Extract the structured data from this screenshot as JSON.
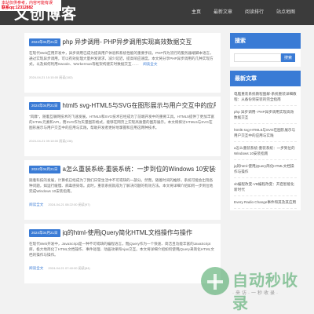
{
  "header": {
    "logo": "文创博客",
    "promo_line1": "本站仅供参考，内容可能有误",
    "promo_line2": "联系qq:12312882",
    "nav": [
      "主页",
      "最新文章",
      "阅读排行",
      "站点地图"
    ]
  },
  "posts": [
    {
      "date": "2024年04月21日",
      "title": "php 异步调用- PHP异步调用实现高效数据交互",
      "body": "在现代Web应用开发中，异步调用已成为提高用户体验和系统性能的重要手段。PHP作为流行的服务器端脚本语言，通过实现异步调用，可以有效处理大量并发请求，减少延迟，提高响应速度。本文将分享PHP异步调用的几种实现方式，以及如何利用Swoole、Workerman等框架构建实时数据交互……",
      "more": "阅读全文",
      "meta": "2024-04-21 10:15:00  阅读(182)"
    },
    {
      "date": "2024年04月21日",
      "title": "html5 svg-HTML5与SVG在图形展示与用户交互中的应用与实践",
      "body": "\"风靡\"，随着互联网技术的飞速发展，HTML5和SVG技术已经成为了前端开发中的重要工具。HTML5提供了更加丰富的HTML元素和API，而SVG作为矢量图形格式，能够在网页上实现高质量的图形展示。本文将探讨HTML5与SVG在图形展示与用户交互中的应用与实践，帮助开发者更好地掌握和应用这两种技术。",
      "more": "",
      "meta": "2024-04-21 09:18:00  阅读(136)"
    },
    {
      "date": "2024年04月21日",
      "title": "a怎么重装系统-重装系统：一步到位的Windows 10安装指南",
      "body": "随着科技的发展，计算机已经成为了我们日常生活中不可或缺的一部分。然而，随着时间的推移，系统可能会出现各种问题，如运行缓慢、病毒感染等。此时，重装系统就成为了解决问题的有效方法。本文将详细介绍如何一步到位地完成Windows 10安装指南。",
      "more": "阅读全文",
      "meta": "2024-04-21 08:22:00  阅读(97)"
    },
    {
      "date": "2024年04月21日",
      "title": "jq的html-使用jQuery简化HTML文档操作与操作",
      "body": "在现代Web开发中，JavaScript是一种不可或缺的编程语言，而jQuery作为一个快速、简洁且功能丰富的JavaScript库，极大地简化了HTML文档操作、事件处理、动画效果和Ajax交互。本文将详细介绍如何使用jQuery来简化HTML文档的操作与操作。",
      "more": "阅读全文",
      "meta": "2024-04-21 07:40:00  阅读(84)"
    }
  ],
  "sidebar": {
    "search_title": "搜索",
    "search_placeholder": "",
    "search_button": "搜索",
    "latest_title": "最新文章",
    "latest": [
      "电脑重装系统教程图解-系统重装详细教程：从备份到安装的完全指南",
      "php 异步调用- PHP异步调用实现高效数据交互",
      "html5 svg-HTML5与SVG在图形展示与用户交互中的应用与实践",
      "a怎么重装系统-重装系统：一步到位的Windows 10安装指南",
      "jq的html-使用jQuery简化HTML文档操作与操作",
      "vb编程改变-VB编程改变：开启智能化新时代",
      "Every Radio Change事件和其及其应用"
    ]
  },
  "watermark": {
    "name": "自动秒收录",
    "slogan": "·来访·一秒收录·"
  }
}
